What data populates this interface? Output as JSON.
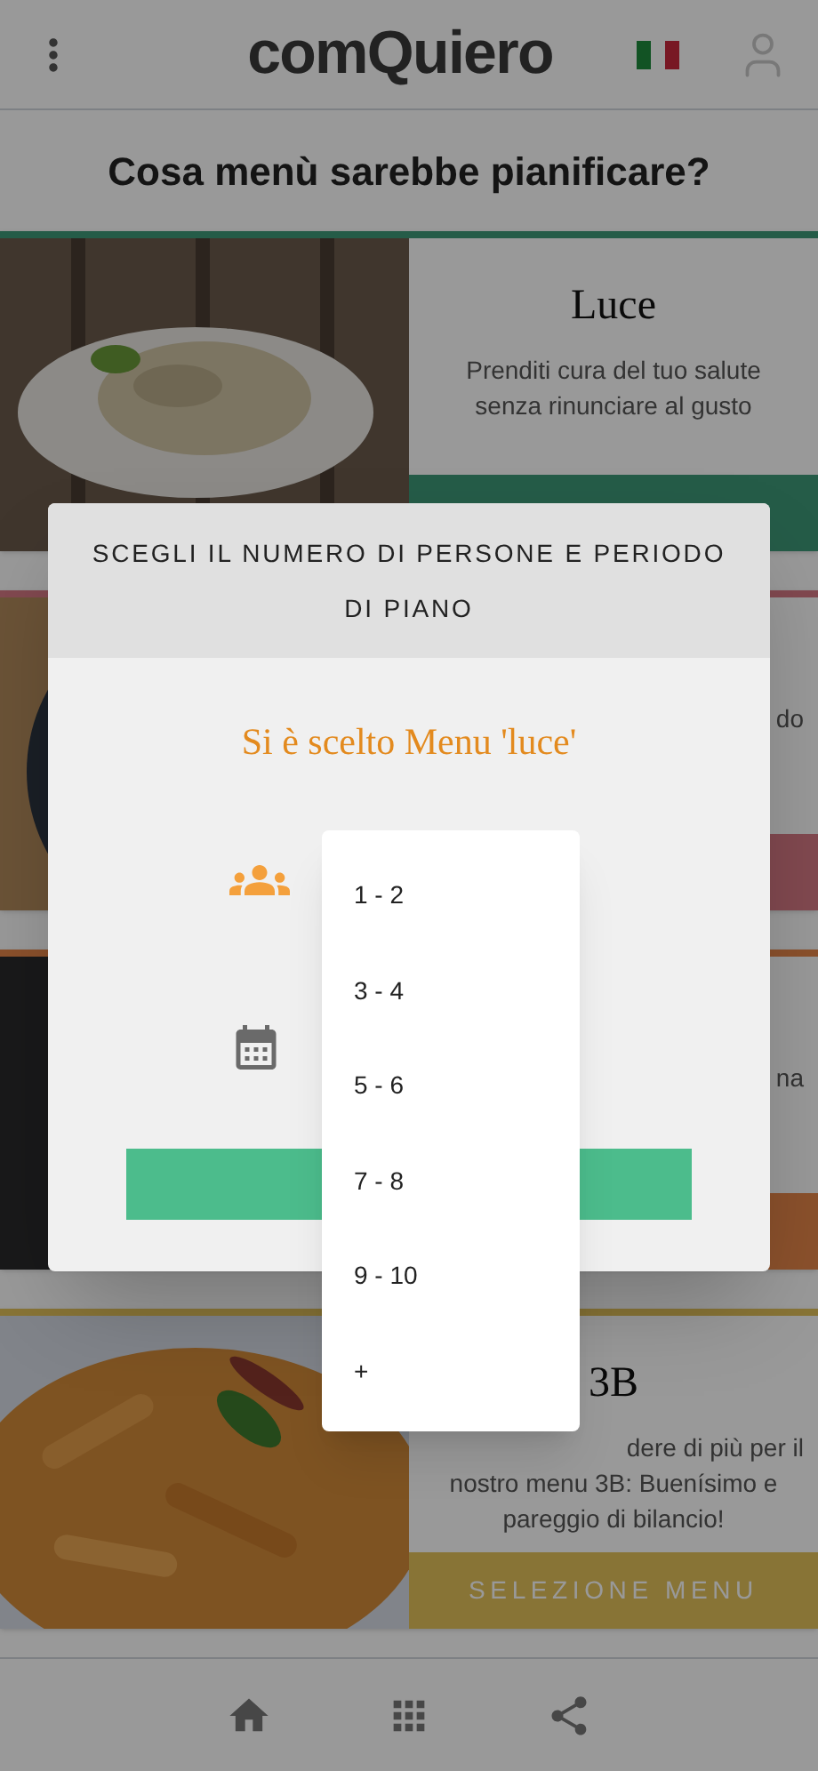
{
  "header": {
    "logo": "comQuiero"
  },
  "heading": "Cosa menù sarebbe pianificare?",
  "cards": [
    {
      "title": "Luce",
      "lines": [
        "Prenditi cura del tuo salute",
        "senza rinunciare al gusto"
      ]
    },
    {
      "lines": [
        "do"
      ]
    },
    {
      "lines": [
        "na"
      ]
    },
    {
      "title": "3B",
      "lines": [
        "dere di più per il",
        "nostro menu 3B: Buenísimo e",
        "pareggio di bilancio!"
      ],
      "button": "SELEZIONE MENU"
    }
  ],
  "dialog": {
    "title": "SCEGLI IL NUMERO DI PERSONE E PERIODO DI PIANO",
    "subtitle": "Si è scelto Menu 'luce'"
  },
  "dropdown": {
    "options": [
      "1 - 2",
      "3 - 4",
      "5 - 6",
      "7 - 8",
      "9 - 10",
      "+"
    ]
  }
}
